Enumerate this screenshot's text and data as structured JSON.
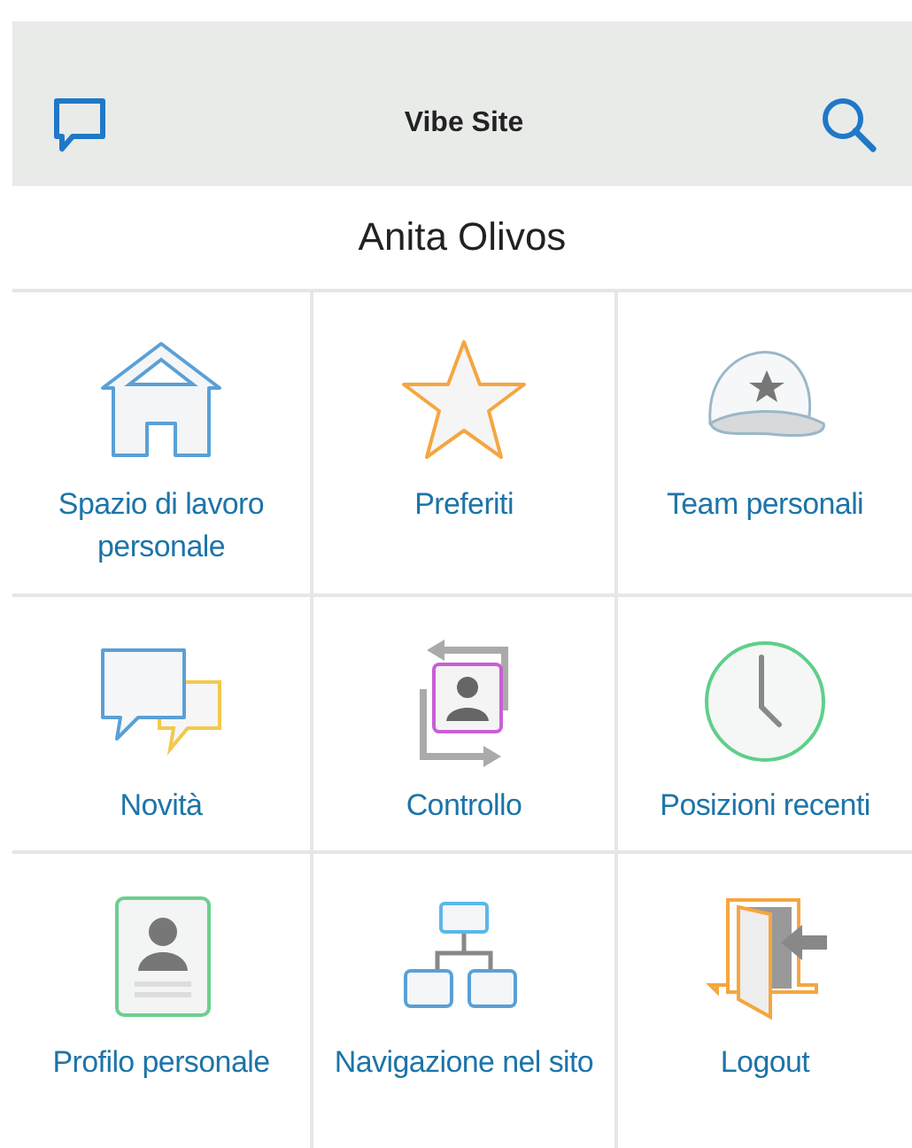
{
  "header": {
    "title": "Vibe Site"
  },
  "user": {
    "name": "Anita Olivos"
  },
  "tiles": [
    {
      "kind": "home",
      "label": "Spazio di lavoro personale"
    },
    {
      "kind": "star",
      "label": "Preferiti"
    },
    {
      "kind": "cap",
      "label": "Team personali"
    },
    {
      "kind": "chat",
      "label": "Novità"
    },
    {
      "kind": "tracking",
      "label": "Controllo"
    },
    {
      "kind": "clock",
      "label": "Posizioni recenti"
    },
    {
      "kind": "profile",
      "label": "Profilo personale"
    },
    {
      "kind": "sitemap",
      "label": "Navigazione nel sito"
    },
    {
      "kind": "logout",
      "label": "Logout"
    }
  ]
}
